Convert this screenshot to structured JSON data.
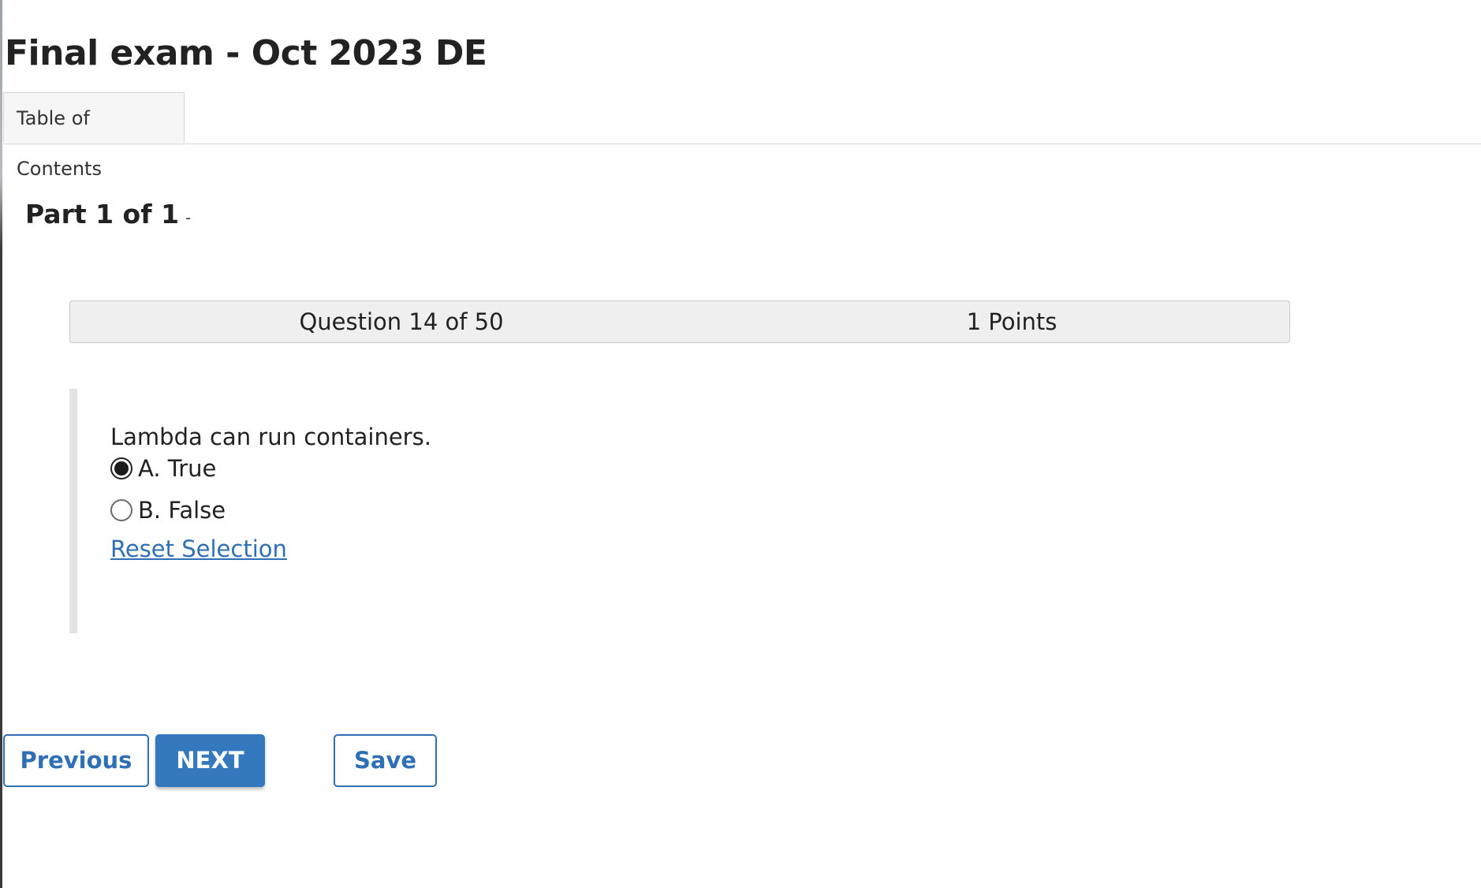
{
  "exam": {
    "title": "Final exam - Oct 2023 DE"
  },
  "tabs": {
    "toc_label": "Table of Contents"
  },
  "part": {
    "label": "Part 1 of 1",
    "separator": "-"
  },
  "question": {
    "number_label": "Question 14 of 50",
    "points_label": "1 Points",
    "text": "Lambda can run containers.",
    "options": [
      {
        "label": "A. True",
        "selected": true
      },
      {
        "label": "B. False",
        "selected": false
      }
    ],
    "reset_label": "Reset Selection"
  },
  "nav": {
    "previous_label": "Previous",
    "next_label": "NEXT",
    "save_label": "Save"
  },
  "colors": {
    "accent": "#2e6fb6",
    "primary_button": "#3478be",
    "header_bg": "#efefef"
  }
}
